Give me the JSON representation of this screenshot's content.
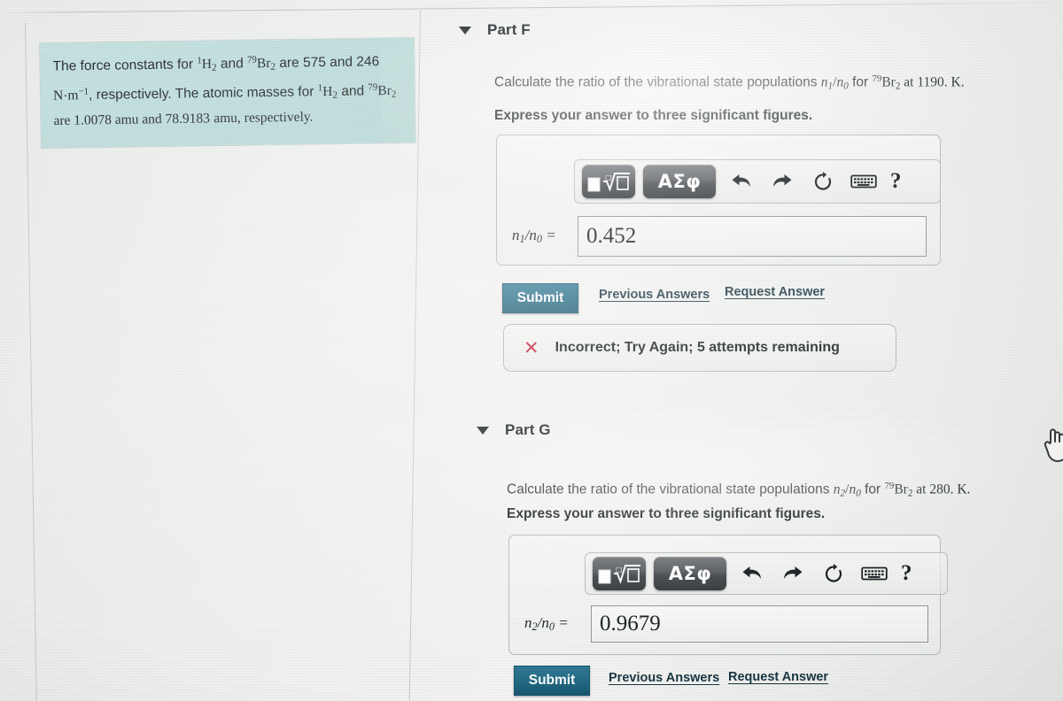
{
  "problem_statement": {
    "line1_a": "The force constants for ",
    "iso_h": "1",
    "mol_h": "H",
    "mol_h_sub": "2",
    "and_1": " and ",
    "iso_br": "79",
    "mol_br": "Br",
    "mol_br_sub": "2",
    "line1_b": " are 575",
    "line2_a": "and 246 ",
    "unit": "N",
    "unit_dot": "·",
    "unit_m": "m",
    "unit_exp": "−1",
    "line2_b": ", respectively. The atomic masses",
    "line3_a": "for ",
    "line3_b": " are 1.0078 amu and 78.9183",
    "line4": "amu, respectively."
  },
  "parts": [
    {
      "id": "part-f",
      "title": "Part F",
      "prompt_pre": "Calculate the ratio of the vibrational state populations ",
      "prompt_ratio_n": "n",
      "prompt_ratio_n_sub": "1",
      "prompt_ratio_sep": "/",
      "prompt_ratio_d": "n",
      "prompt_ratio_d_sub": "0",
      "prompt_mid": " for ",
      "prompt_iso": "79",
      "prompt_mol": "Br",
      "prompt_mol_sub": "2",
      "prompt_post": " at 1190. K.",
      "instruction": "Express your answer to three significant figures.",
      "answer_label_n": "n",
      "answer_label_n_sub": "1",
      "answer_label_sep": "/",
      "answer_label_d": "n",
      "answer_label_d_sub": "0",
      "answer_label_eq": " =",
      "answer_value": "0.452",
      "submit_label": "Submit",
      "previous_answers_label": "Previous Answers",
      "request_answer_label": "Request Answer",
      "feedback": {
        "icon": "x-mark",
        "text": "Incorrect; Try Again; 5 attempts remaining"
      }
    },
    {
      "id": "part-g",
      "title": "Part G",
      "prompt_pre": "Calculate the ratio of the vibrational state populations ",
      "prompt_ratio_n": "n",
      "prompt_ratio_n_sub": "2",
      "prompt_ratio_sep": "/",
      "prompt_ratio_d": "n",
      "prompt_ratio_d_sub": "0",
      "prompt_mid": " for ",
      "prompt_iso": "79",
      "prompt_mol": "Br",
      "prompt_mol_sub": "2",
      "prompt_post": " at 280. K.",
      "instruction": "Express your answer to three significant figures.",
      "answer_label_n": "n",
      "answer_label_n_sub": "2",
      "answer_label_sep": "/",
      "answer_label_d": "n",
      "answer_label_d_sub": "0",
      "answer_label_eq": " =",
      "answer_value": "0.9679",
      "submit_label": "Submit",
      "previous_answers_label": "Previous Answers",
      "request_answer_label": "Request Answer"
    }
  ],
  "toolbar": {
    "template_button_icon": "math-template-radical-icon",
    "greek_button_label": "ΑΣφ",
    "undo_icon": "undo-arrow-icon",
    "redo_icon": "redo-arrow-icon",
    "reset_icon": "reset-circle-icon",
    "keyboard_icon": "keyboard-icon",
    "help_label": "?"
  },
  "cursor": {
    "icon": "pointing-hand-cursor"
  },
  "colors": {
    "callout_bg": "#bcdcda",
    "submit_bg": "#1d6580",
    "link_text": "#16333f",
    "error_red": "#c2172a",
    "text_dark": "#13191d"
  }
}
